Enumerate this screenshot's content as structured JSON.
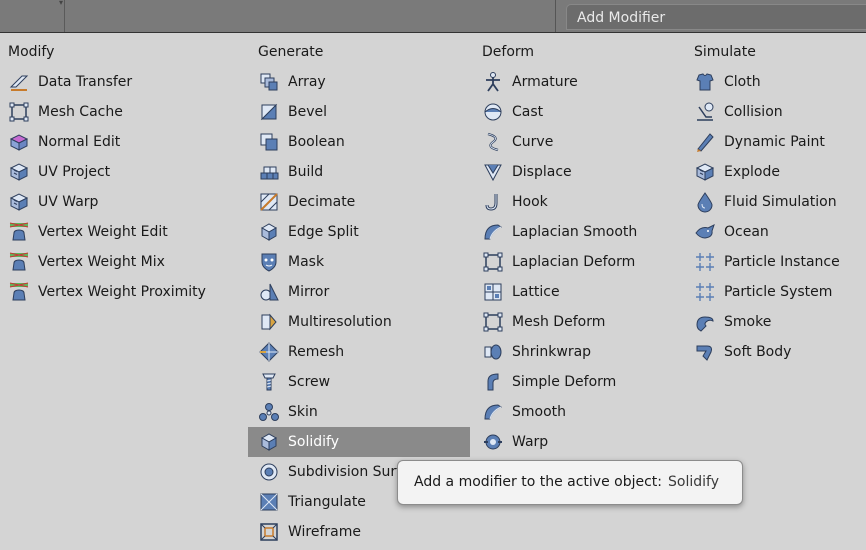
{
  "header": {
    "add_modifier": "Add Modifier"
  },
  "columns": [
    {
      "title": "Modify",
      "items": [
        {
          "label": "Data Transfer",
          "icon": "data-transfer-icon"
        },
        {
          "label": "Mesh Cache",
          "icon": "mesh-cache-icon"
        },
        {
          "label": "Normal Edit",
          "icon": "normal-edit-icon"
        },
        {
          "label": "UV Project",
          "icon": "uv-project-icon"
        },
        {
          "label": "UV Warp",
          "icon": "uv-warp-icon"
        },
        {
          "label": "Vertex Weight Edit",
          "icon": "vertex-weight-icon"
        },
        {
          "label": "Vertex Weight Mix",
          "icon": "vertex-weight-icon"
        },
        {
          "label": "Vertex Weight Proximity",
          "icon": "vertex-weight-icon"
        }
      ]
    },
    {
      "title": "Generate",
      "items": [
        {
          "label": "Array",
          "icon": "array-icon"
        },
        {
          "label": "Bevel",
          "icon": "bevel-icon"
        },
        {
          "label": "Boolean",
          "icon": "boolean-icon"
        },
        {
          "label": "Build",
          "icon": "build-icon"
        },
        {
          "label": "Decimate",
          "icon": "decimate-icon"
        },
        {
          "label": "Edge Split",
          "icon": "edge-split-icon"
        },
        {
          "label": "Mask",
          "icon": "mask-icon"
        },
        {
          "label": "Mirror",
          "icon": "mirror-icon"
        },
        {
          "label": "Multiresolution",
          "icon": "multiresolution-icon"
        },
        {
          "label": "Remesh",
          "icon": "remesh-icon"
        },
        {
          "label": "Screw",
          "icon": "screw-icon"
        },
        {
          "label": "Skin",
          "icon": "skin-icon"
        },
        {
          "label": "Solidify",
          "icon": "solidify-icon",
          "selected": true
        },
        {
          "label": "Subdivision Surface",
          "icon": "subdivision-icon"
        },
        {
          "label": "Triangulate",
          "icon": "triangulate-icon"
        },
        {
          "label": "Wireframe",
          "icon": "wireframe-icon"
        }
      ]
    },
    {
      "title": "Deform",
      "items": [
        {
          "label": "Armature",
          "icon": "armature-icon"
        },
        {
          "label": "Cast",
          "icon": "cast-icon"
        },
        {
          "label": "Curve",
          "icon": "curve-icon"
        },
        {
          "label": "Displace",
          "icon": "displace-icon"
        },
        {
          "label": "Hook",
          "icon": "hook-icon"
        },
        {
          "label": "Laplacian Smooth",
          "icon": "laplacian-smooth-icon"
        },
        {
          "label": "Laplacian Deform",
          "icon": "laplacian-deform-icon"
        },
        {
          "label": "Lattice",
          "icon": "lattice-icon"
        },
        {
          "label": "Mesh Deform",
          "icon": "mesh-deform-icon"
        },
        {
          "label": "Shrinkwrap",
          "icon": "shrinkwrap-icon"
        },
        {
          "label": "Simple Deform",
          "icon": "simple-deform-icon"
        },
        {
          "label": "Smooth",
          "icon": "smooth-icon"
        },
        {
          "label": "Warp",
          "icon": "warp-icon"
        }
      ]
    },
    {
      "title": "Simulate",
      "items": [
        {
          "label": "Cloth",
          "icon": "cloth-icon"
        },
        {
          "label": "Collision",
          "icon": "collision-icon"
        },
        {
          "label": "Dynamic Paint",
          "icon": "dynamic-paint-icon"
        },
        {
          "label": "Explode",
          "icon": "explode-icon"
        },
        {
          "label": "Fluid Simulation",
          "icon": "fluid-icon"
        },
        {
          "label": "Ocean",
          "icon": "ocean-icon"
        },
        {
          "label": "Particle Instance",
          "icon": "particle-icon"
        },
        {
          "label": "Particle System",
          "icon": "particle-icon"
        },
        {
          "label": "Smoke",
          "icon": "smoke-icon"
        },
        {
          "label": "Soft Body",
          "icon": "soft-body-icon"
        }
      ]
    }
  ],
  "tooltip": {
    "text": "Add a modifier to the active object:",
    "value": "Solidify"
  }
}
